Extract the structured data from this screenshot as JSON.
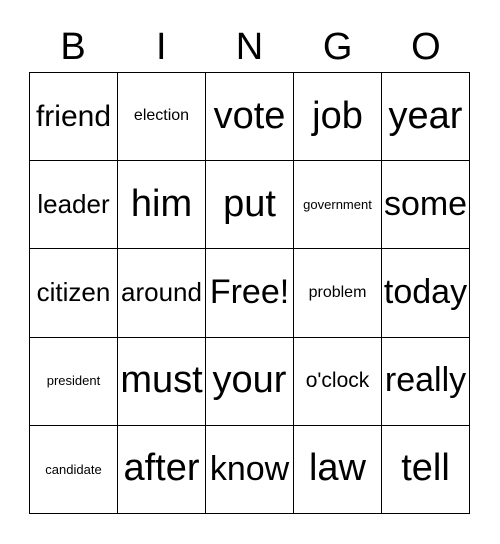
{
  "card": {
    "title": "BINGO",
    "free_space_label": "Free!",
    "colors": {
      "background": "#ffffff",
      "text": "#000000",
      "grid_line": "#000000"
    },
    "header": {
      "letters": [
        "B",
        "I",
        "N",
        "G",
        "O"
      ]
    },
    "grid": {
      "columns": 5,
      "rows": 5,
      "cells": [
        [
          {
            "text": "friend",
            "size": "lg"
          },
          {
            "text": "election",
            "size": "xs"
          },
          {
            "text": "vote",
            "size": "xxl"
          },
          {
            "text": "job",
            "size": "xxl"
          },
          {
            "text": "year",
            "size": "xxl"
          }
        ],
        [
          {
            "text": "leader",
            "size": "md"
          },
          {
            "text": "him",
            "size": "xxl"
          },
          {
            "text": "put",
            "size": "xxl"
          },
          {
            "text": "government",
            "size": "xxs"
          },
          {
            "text": "some",
            "size": "xl"
          }
        ],
        [
          {
            "text": "citizen",
            "size": "md"
          },
          {
            "text": "around",
            "size": "md"
          },
          {
            "text": "Free!",
            "size": "xl"
          },
          {
            "text": "problem",
            "size": "xs"
          },
          {
            "text": "today",
            "size": "xl"
          }
        ],
        [
          {
            "text": "president",
            "size": "xxs"
          },
          {
            "text": "must",
            "size": "xxl"
          },
          {
            "text": "your",
            "size": "xxl"
          },
          {
            "text": "o'clock",
            "size": "sm"
          },
          {
            "text": "really",
            "size": "xl"
          }
        ],
        [
          {
            "text": "candidate",
            "size": "xxs"
          },
          {
            "text": "after",
            "size": "xxl"
          },
          {
            "text": "know",
            "size": "xl"
          },
          {
            "text": "law",
            "size": "xxl"
          },
          {
            "text": "tell",
            "size": "xxl"
          }
        ]
      ]
    }
  }
}
